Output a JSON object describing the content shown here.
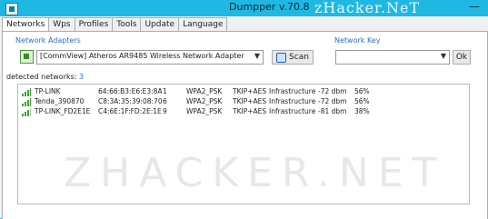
{
  "window": {
    "title": "Dumpper v.70.8",
    "brand": "zHacker.NeT",
    "minimize_glyph": "—"
  },
  "tabs": [
    {
      "label": "Networks",
      "active": true
    },
    {
      "label": "Wps"
    },
    {
      "label": "Profiles"
    },
    {
      "label": "Tools"
    },
    {
      "label": "Update"
    },
    {
      "label": "Language"
    }
  ],
  "adapters": {
    "label": "Network Adapters",
    "selected": "[CommView] Atheros AR9485 Wireless Network Adapter",
    "scan_label": "Scan"
  },
  "network_key": {
    "label": "Network Key",
    "value": "",
    "ok_label": "Ok"
  },
  "detected": {
    "label": "detected networks:",
    "count": "3"
  },
  "networks": [
    {
      "ssid": "TP-LINK",
      "bssid": "64:66:B3:E6:E3:8A",
      "channel": "1",
      "auth": "WPA2_PSK",
      "cipher": "TKIP+AES",
      "mode": "Infrastructure",
      "rssi": "-72 dbm",
      "quality": "56%"
    },
    {
      "ssid": "Tenda_390870",
      "bssid": "C8:3A:35:39:08:70",
      "channel": "6",
      "auth": "WPA2_PSK",
      "cipher": "TKIP+AES",
      "mode": "Infrastructure",
      "rssi": "-72 dbm",
      "quality": "56%"
    },
    {
      "ssid": "TP-LINK_FD2E1E",
      "bssid": "C4:6E:1F:FD:2E:1E",
      "channel": "9",
      "auth": "WPA2_PSK",
      "cipher": "TKIP+AES",
      "mode": "Infrastructure",
      "rssi": "-81 dbm",
      "quality": "38%"
    }
  ],
  "watermark": "ZHACKER.NET",
  "colors": {
    "accent": "#1fb8e3",
    "link": "#2a6fc0",
    "signal": "#3fa535"
  }
}
